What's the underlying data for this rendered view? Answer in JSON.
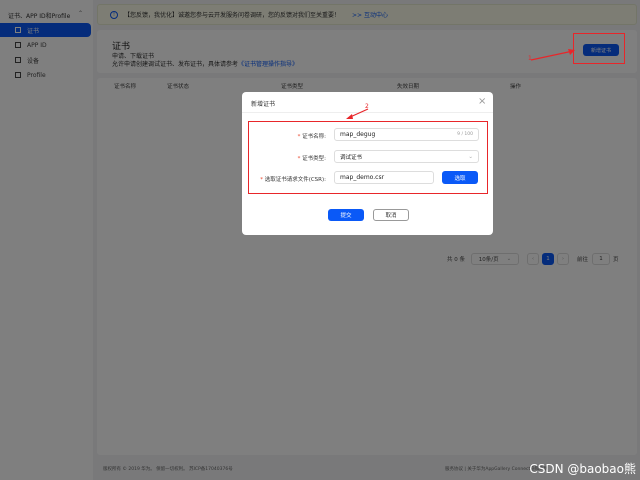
{
  "sidebar": {
    "title": "证书、APP ID和Profile",
    "items": [
      {
        "label": "证书",
        "active": true
      },
      {
        "label": "APP ID"
      },
      {
        "label": "设备"
      },
      {
        "label": "Profile"
      }
    ]
  },
  "banner": {
    "text": "【您反馈，我优化】诚邀您参与云开发服务问卷调研，您的反馈对我们至关重要！",
    "link": ">> 互动中心"
  },
  "header": {
    "title": "证书",
    "desc1": "申请、下载证书",
    "desc2": "允许申请创建调试证书、发布证书，具体请参考",
    "desc_link": "《证书管理操作指导》",
    "new_button": "新增证书"
  },
  "table": {
    "columns": [
      "证书名称",
      "证书状态",
      "证书类型",
      "失效日期",
      "操作"
    ]
  },
  "pagination": {
    "total": "共 0 条",
    "page_size": "10条/页",
    "prev": "‹",
    "current": "1",
    "next": "›",
    "goto_label": "前往",
    "goto_value": "1",
    "goto_unit": "页"
  },
  "footer": {
    "left": "版权所有 © 2019 华为。 保留一切权利。 苏ICP备17040376号",
    "right": "服务协议 | 关于华为AppGallery Connect隐私声明"
  },
  "dialog": {
    "title": "新增证书",
    "close": "×",
    "fields": [
      {
        "label": "证书名称:",
        "value": "map_degug",
        "counter": "9 / 100"
      },
      {
        "label": "证书类型:",
        "value": "调试证书"
      },
      {
        "label": "选取证书请求文件(CSR):",
        "value": "map_demo.csr",
        "button": "选取"
      }
    ],
    "submit": "提交",
    "cancel": "取消"
  },
  "annotations": {
    "one": "1",
    "two": "2"
  },
  "watermark": "CSDN @baobao熊",
  "colors": {
    "primary": "#0a59f7",
    "annotation": "#e8262a"
  }
}
